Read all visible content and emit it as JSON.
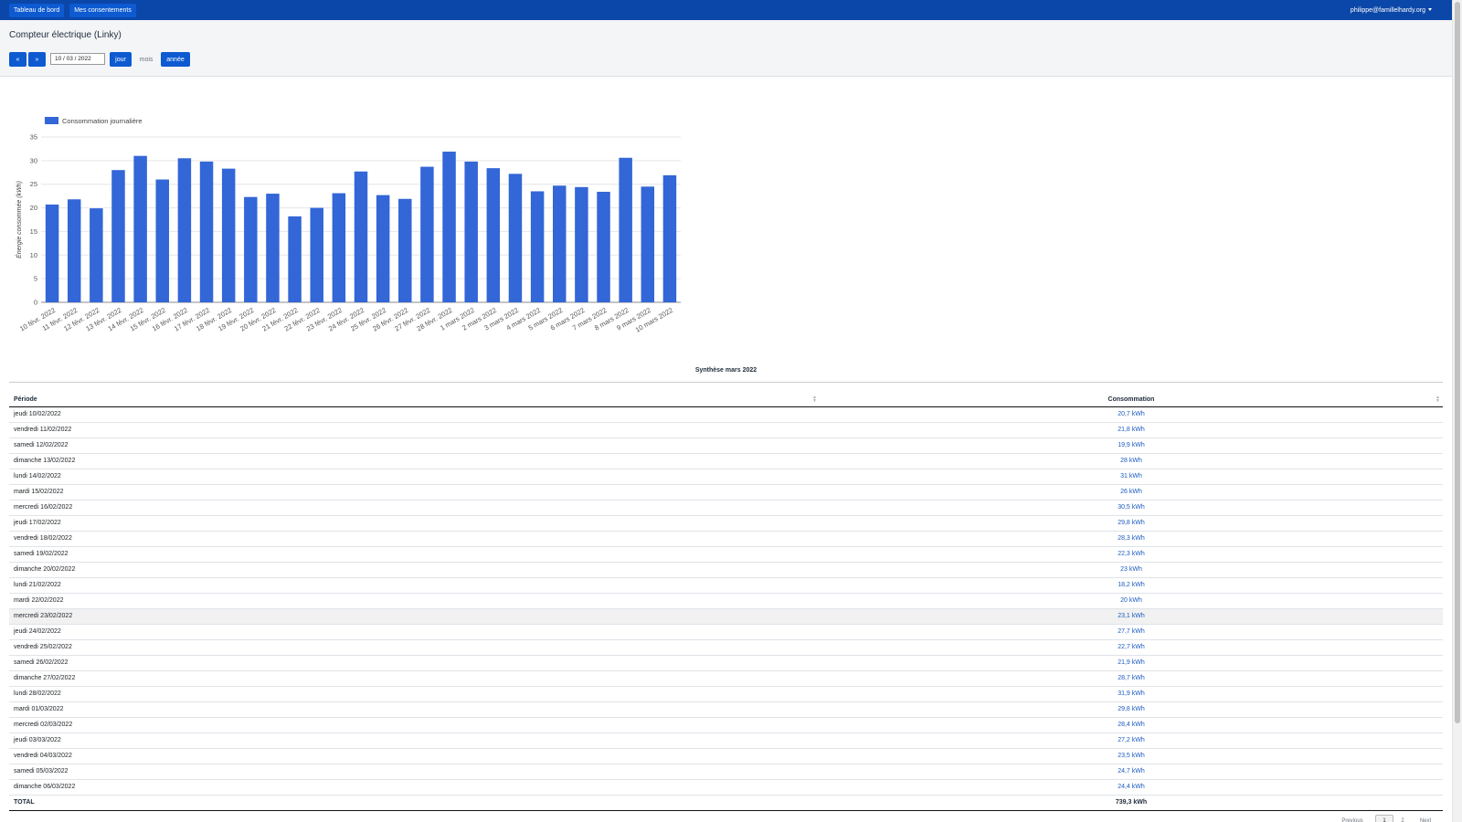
{
  "navbar": {
    "dashboard_label": "Tableau de bord",
    "consents_label": "Mes consentements",
    "user_email": "philippe@famillelhardy.org"
  },
  "header": {
    "title": "Compteur électrique (Linky)",
    "prev_label": "«",
    "next_label": "»",
    "date_value": "10 / 03 / 2022",
    "day_label": "jour",
    "month_label": "mois",
    "year_label": "année"
  },
  "chart_data": {
    "type": "bar",
    "legend": "Consommation journalière",
    "legend_position": "top-left",
    "ylabel": "Énergie consommée (kWh)",
    "ylim": [
      0,
      35
    ],
    "yticks": [
      0,
      5,
      10,
      15,
      20,
      25,
      30,
      35
    ],
    "grid": true,
    "color": "#3366d6",
    "categories": [
      "10 févr. 2022",
      "11 févr. 2022",
      "12 févr. 2022",
      "13 févr. 2022",
      "14 févr. 2022",
      "15 févr. 2022",
      "16 févr. 2022",
      "17 févr. 2022",
      "18 févr. 2022",
      "19 févr. 2022",
      "20 févr. 2022",
      "21 févr. 2022",
      "22 févr. 2022",
      "23 févr. 2022",
      "24 févr. 2022",
      "25 févr. 2022",
      "26 févr. 2022",
      "27 févr. 2022",
      "28 févr. 2022",
      "1 mars 2022",
      "2 mars 2022",
      "3 mars 2022",
      "4 mars 2022",
      "5 mars 2022",
      "6 mars 2022",
      "7 mars 2022",
      "8 mars 2022",
      "9 mars 2022",
      "10 mars 2022"
    ],
    "values": [
      20.7,
      21.8,
      19.9,
      28,
      31,
      26,
      30.5,
      29.8,
      28.3,
      22.3,
      23,
      18.2,
      20,
      23.1,
      27.7,
      22.7,
      21.9,
      28.7,
      31.9,
      29.8,
      28.4,
      27.2,
      23.5,
      24.7,
      24.4,
      23.4,
      30.6,
      24.5,
      26.9
    ]
  },
  "table": {
    "title": "Synthèse mars 2022",
    "col_period": "Période",
    "col_consumption": "Consommation",
    "rows": [
      [
        "jeudi 10/02/2022",
        "20,7 kWh"
      ],
      [
        "vendredi 11/02/2022",
        "21,8 kWh"
      ],
      [
        "samedi 12/02/2022",
        "19,9 kWh"
      ],
      [
        "dimanche 13/02/2022",
        "28 kWh"
      ],
      [
        "lundi 14/02/2022",
        "31 kWh"
      ],
      [
        "mardi 15/02/2022",
        "26 kWh"
      ],
      [
        "mercredi 16/02/2022",
        "30,5 kWh"
      ],
      [
        "jeudi 17/02/2022",
        "29,8 kWh"
      ],
      [
        "vendredi 18/02/2022",
        "28,3 kWh"
      ],
      [
        "samedi 19/02/2022",
        "22,3 kWh"
      ],
      [
        "dimanche 20/02/2022",
        "23 kWh"
      ],
      [
        "lundi 21/02/2022",
        "18,2 kWh"
      ],
      [
        "mardi 22/02/2022",
        "20 kWh"
      ],
      [
        "mercredi 23/02/2022",
        "23,1 kWh"
      ],
      [
        "jeudi 24/02/2022",
        "27,7 kWh"
      ],
      [
        "vendredi 25/02/2022",
        "22,7 kWh"
      ],
      [
        "samedi 26/02/2022",
        "21,9 kWh"
      ],
      [
        "dimanche 27/02/2022",
        "28,7 kWh"
      ],
      [
        "lundi 28/02/2022",
        "31,9 kWh"
      ],
      [
        "mardi 01/03/2022",
        "29,8 kWh"
      ],
      [
        "mercredi 02/03/2022",
        "28,4 kWh"
      ],
      [
        "jeudi 03/03/2022",
        "27,2 kWh"
      ],
      [
        "vendredi 04/03/2022",
        "23,5 kWh"
      ],
      [
        "samedi 05/03/2022",
        "24,7 kWh"
      ],
      [
        "dimanche 06/03/2022",
        "24,4 kWh"
      ]
    ],
    "highlighted_row": 13,
    "total_label": "TOTAL",
    "total_value": "739,3 kWh"
  },
  "pagination": {
    "previous_label": "Previous",
    "page_1": "1",
    "page_2": "2",
    "next_label": "Next"
  }
}
